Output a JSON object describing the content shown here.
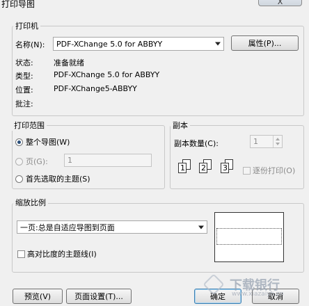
{
  "window": {
    "title": "打印导图",
    "close_label": "X"
  },
  "printer": {
    "legend": "打印机",
    "name_label": "名称(N):",
    "name_value": "PDF-XChange 5.0 for ABBYY",
    "properties_button": "属性(P)...",
    "status_label": "状态:",
    "status_value": "准备就绪",
    "type_label": "类型:",
    "type_value": "PDF-XChange 5.0 for ABBYY",
    "location_label": "位置:",
    "location_value": "PDF-XChange5-ABBYY",
    "comment_label": "批注:"
  },
  "range": {
    "legend": "打印范围",
    "whole_map": "整个导图(W)",
    "pages": "页(G):",
    "pages_value": "1",
    "selected_topics": "首先选取的主题(S)",
    "selected": "whole_map"
  },
  "copies": {
    "legend": "副本",
    "count_label": "副本数量(C):",
    "count_value": "1",
    "collate_label": "逐份打印(O)",
    "page_numbers": [
      "1",
      "2",
      "3"
    ]
  },
  "scale": {
    "legend": "缩放比例",
    "mode_value": "一页:总是自适应导图到页面",
    "high_contrast_label": "高对比度的主题线(I)"
  },
  "buttons": {
    "preview": "预览(V)",
    "page_setup": "页面设置(T)...",
    "ok": "确定",
    "cancel": "取消"
  },
  "watermark": {
    "text": "下载银行",
    "url": "www.xiazaiyh.cn"
  }
}
